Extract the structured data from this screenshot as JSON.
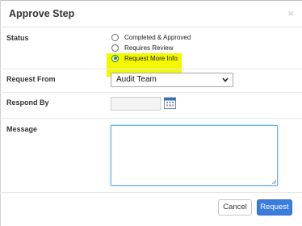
{
  "dialog": {
    "title": "Approve Step",
    "close_icon": "close-icon"
  },
  "status": {
    "label": "Status",
    "options": [
      {
        "label": "Completed & Approved",
        "selected": false
      },
      {
        "label": "Requires Review",
        "selected": false
      },
      {
        "label": "Request More Info",
        "selected": true
      }
    ],
    "highlight_color": "#f3f700"
  },
  "request_from": {
    "label": "Request From",
    "value": "Audit Team",
    "icon": "chevron-down-icon"
  },
  "respond_by": {
    "label": "Respond By",
    "value": "",
    "icon": "calendar-icon"
  },
  "message": {
    "label": "Message",
    "value": ""
  },
  "footer": {
    "cancel_label": "Cancel",
    "request_label": "Request",
    "accent": "#3b7ddc"
  }
}
